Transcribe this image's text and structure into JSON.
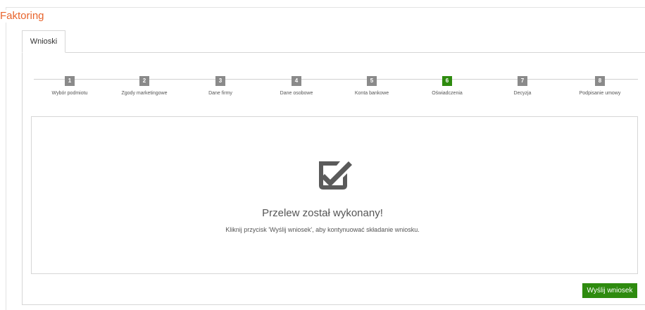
{
  "page": {
    "title": "Faktoring"
  },
  "tabs": [
    {
      "label": "Wnioski"
    }
  ],
  "stepper": {
    "steps": [
      {
        "number": "1",
        "label": "Wybór podmiotu"
      },
      {
        "number": "2",
        "label": "Zgody marketingowe"
      },
      {
        "number": "3",
        "label": "Dane firmy"
      },
      {
        "number": "4",
        "label": "Dane osobowe"
      },
      {
        "number": "5",
        "label": "Konta bankowe"
      },
      {
        "number": "6",
        "label": "Oświadczenia"
      },
      {
        "number": "7",
        "label": "Decyzja"
      },
      {
        "number": "8",
        "label": "Podpisanie umowy"
      }
    ],
    "active_step": 6
  },
  "message": {
    "icon": "checkbox-checked-icon",
    "title": "Przelew został wykonany!",
    "subtitle": "Kliknij przycisk 'Wyślij wniosek', aby kontynuować składanie wniosku."
  },
  "actions": {
    "submit_label": "Wyślij wniosek"
  },
  "colors": {
    "brand_orange": "#e8642c",
    "accent_green": "#2e8b0f",
    "step_gray": "#8a8a8a"
  }
}
